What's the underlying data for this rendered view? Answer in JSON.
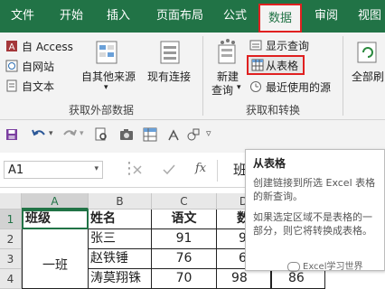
{
  "ribbon_tabs": [
    {
      "label": "文件"
    },
    {
      "label": "开始"
    },
    {
      "label": "插入"
    },
    {
      "label": "页面布局"
    },
    {
      "label": "公式"
    },
    {
      "label": "数据",
      "active": true
    },
    {
      "label": "审阅"
    },
    {
      "label": "视图"
    }
  ],
  "ribbon": {
    "get_external": {
      "access": "自 Access",
      "web": "自网站",
      "text": "自文本",
      "other_sources": "自其他来源",
      "existing": "现有连接",
      "group_label": "获取外部数据"
    },
    "get_transform": {
      "new_query": "新建",
      "new_query_2": "查询",
      "show_queries": "显示查询",
      "from_table": "从表格",
      "recent_sources": "最近使用的源",
      "group_label": "获取和转换"
    },
    "refresh_all": "全部刷"
  },
  "formula_bar": {
    "name_box": "A1",
    "fx": "fx",
    "content": "班"
  },
  "grid": {
    "columns": [
      "A",
      "B",
      "C",
      "D"
    ],
    "rows": [
      "1",
      "2",
      "3",
      "4"
    ],
    "cells": {
      "a1": "班级",
      "b1": "姓名",
      "c1": "语文",
      "d1": "数",
      "b2": "张三",
      "c2": "91",
      "d2": "9",
      "b3": "赵铁锤",
      "c3": "76",
      "d3": "6",
      "a4": "一班",
      "b4": "涛莫翔铢",
      "c4": "70",
      "d4": "98",
      "e4": "86"
    }
  },
  "tooltip": {
    "title": "从表格",
    "body1": "创建链接到所选 Excel 表格的新查询。",
    "body2": "如果选定区域不是表格的一部分，则它将转换成表格。"
  },
  "watermark": "Excel学习世界",
  "colors": {
    "brand": "#217346",
    "highlight": "#e02020"
  }
}
